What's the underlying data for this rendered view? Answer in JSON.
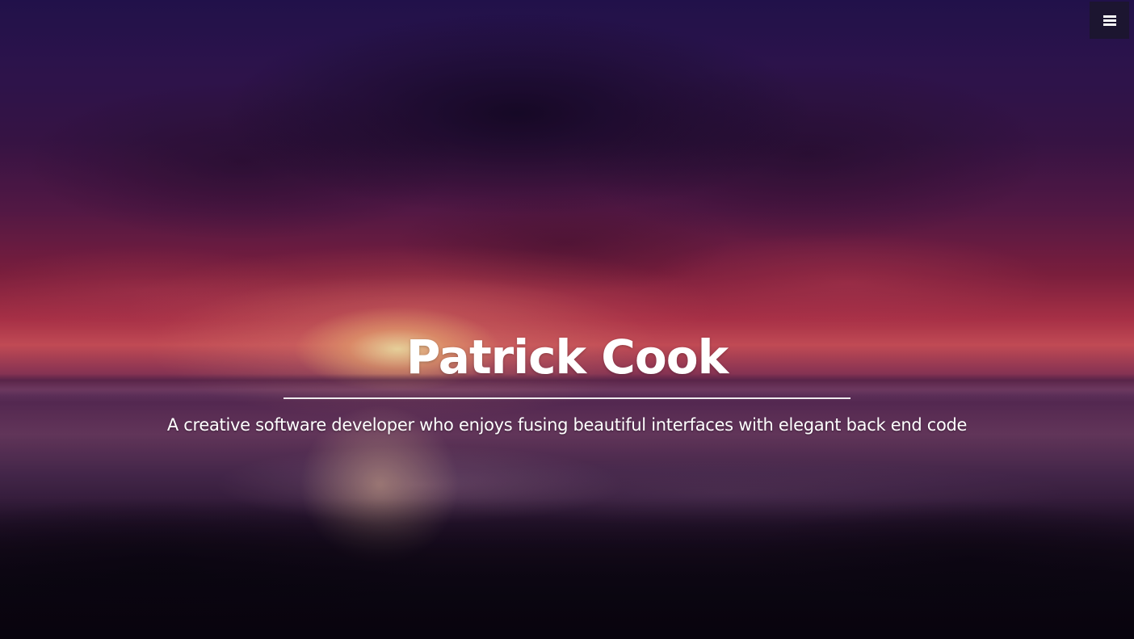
{
  "header": {
    "menu_icon": "hamburger-menu-icon"
  },
  "hero": {
    "title": "Patrick Cook",
    "subtitle": "A creative software developer who enjoys fusing beautiful interfaces with elegant back end code",
    "background_description_colors": {
      "sky_top": "#23124f",
      "sky_mid": "#86213f",
      "sun_glow": "#ffecaa",
      "ground": "#0d0812"
    }
  },
  "colors": {
    "text": "#ffffff",
    "menu_button_bg": "#1c1530",
    "divider": "#ffffff"
  }
}
